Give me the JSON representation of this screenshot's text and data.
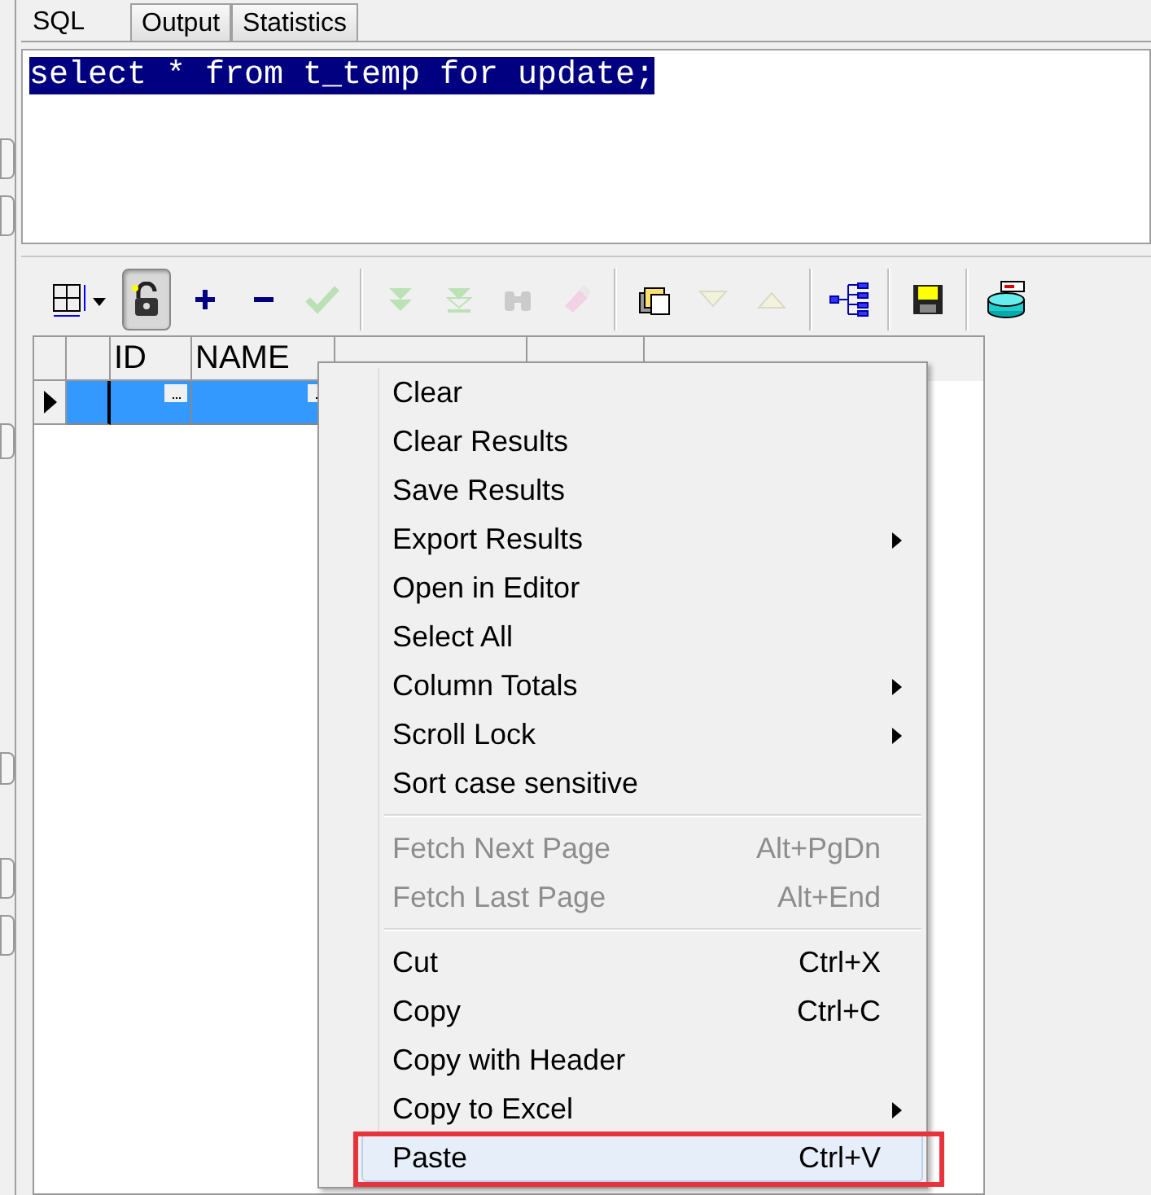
{
  "tabs": [
    {
      "label": "SQL",
      "selected": true
    },
    {
      "label": "Output",
      "selected": false
    },
    {
      "label": "Statistics",
      "selected": false
    }
  ],
  "editor": {
    "text": "select * from t_temp for update;",
    "selected": true
  },
  "toolbar": [
    {
      "kind": "grid",
      "disabled": false,
      "pressed": false
    },
    {
      "kind": "lock",
      "disabled": false,
      "pressed": true
    },
    {
      "kind": "plus",
      "disabled": false,
      "pressed": false
    },
    {
      "kind": "minus",
      "disabled": false,
      "pressed": false
    },
    {
      "kind": "check",
      "disabled": true,
      "pressed": false
    },
    {
      "kind": "separator"
    },
    {
      "kind": "double-down",
      "disabled": true,
      "pressed": false
    },
    {
      "kind": "down-bar",
      "disabled": true,
      "pressed": false
    },
    {
      "kind": "binoculars",
      "disabled": true,
      "pressed": false
    },
    {
      "kind": "eraser",
      "disabled": true,
      "pressed": false
    },
    {
      "kind": "separator"
    },
    {
      "kind": "stack",
      "disabled": false,
      "pressed": false
    },
    {
      "kind": "triangle-down",
      "disabled": true,
      "pressed": false
    },
    {
      "kind": "triangle-up",
      "disabled": true,
      "pressed": false
    },
    {
      "kind": "separator"
    },
    {
      "kind": "tree",
      "disabled": false,
      "pressed": false
    },
    {
      "kind": "separator"
    },
    {
      "kind": "save",
      "disabled": false,
      "pressed": false
    },
    {
      "kind": "separator"
    },
    {
      "kind": "database",
      "disabled": false,
      "pressed": false
    }
  ],
  "grid": {
    "columns": [
      "ID",
      "NAME"
    ],
    "rows": [
      {
        "selected": true,
        "current": true
      }
    ]
  },
  "context_menu": [
    {
      "kind": "item",
      "label": "Clear",
      "disabled": false,
      "submenu": false,
      "selected": false
    },
    {
      "kind": "item",
      "label": "Clear Results",
      "disabled": false,
      "submenu": false,
      "selected": false
    },
    {
      "kind": "item",
      "label": "Save Results",
      "disabled": false,
      "submenu": false,
      "selected": false
    },
    {
      "kind": "item",
      "label": "Export Results",
      "disabled": false,
      "submenu": true,
      "selected": false
    },
    {
      "kind": "item",
      "label": "Open in Editor",
      "disabled": false,
      "submenu": false,
      "selected": false
    },
    {
      "kind": "item",
      "label": "Select All",
      "disabled": false,
      "submenu": false,
      "selected": false
    },
    {
      "kind": "item",
      "label": "Column Totals",
      "disabled": false,
      "submenu": true,
      "selected": false
    },
    {
      "kind": "item",
      "label": "Scroll Lock",
      "disabled": false,
      "submenu": true,
      "selected": false
    },
    {
      "kind": "item",
      "label": "Sort case sensitive",
      "disabled": false,
      "submenu": false,
      "selected": false
    },
    {
      "kind": "separator"
    },
    {
      "kind": "item",
      "label": "Fetch Next Page",
      "shortcut": "Alt+PgDn",
      "disabled": true,
      "submenu": false,
      "selected": false
    },
    {
      "kind": "item",
      "label": "Fetch Last Page",
      "shortcut": "Alt+End",
      "disabled": true,
      "submenu": false,
      "selected": false
    },
    {
      "kind": "separator"
    },
    {
      "kind": "item",
      "label": "Cut",
      "shortcut": "Ctrl+X",
      "disabled": false,
      "submenu": false,
      "selected": false
    },
    {
      "kind": "item",
      "label": "Copy",
      "shortcut": "Ctrl+C",
      "disabled": false,
      "submenu": false,
      "selected": false
    },
    {
      "kind": "item",
      "label": "Copy with Header",
      "disabled": false,
      "submenu": false,
      "selected": false
    },
    {
      "kind": "item",
      "label": "Copy to Excel",
      "disabled": false,
      "submenu": true,
      "selected": false
    },
    {
      "kind": "item",
      "label": "Paste",
      "shortcut": "Ctrl+V",
      "disabled": false,
      "submenu": false,
      "selected": true,
      "annotated": true
    }
  ]
}
